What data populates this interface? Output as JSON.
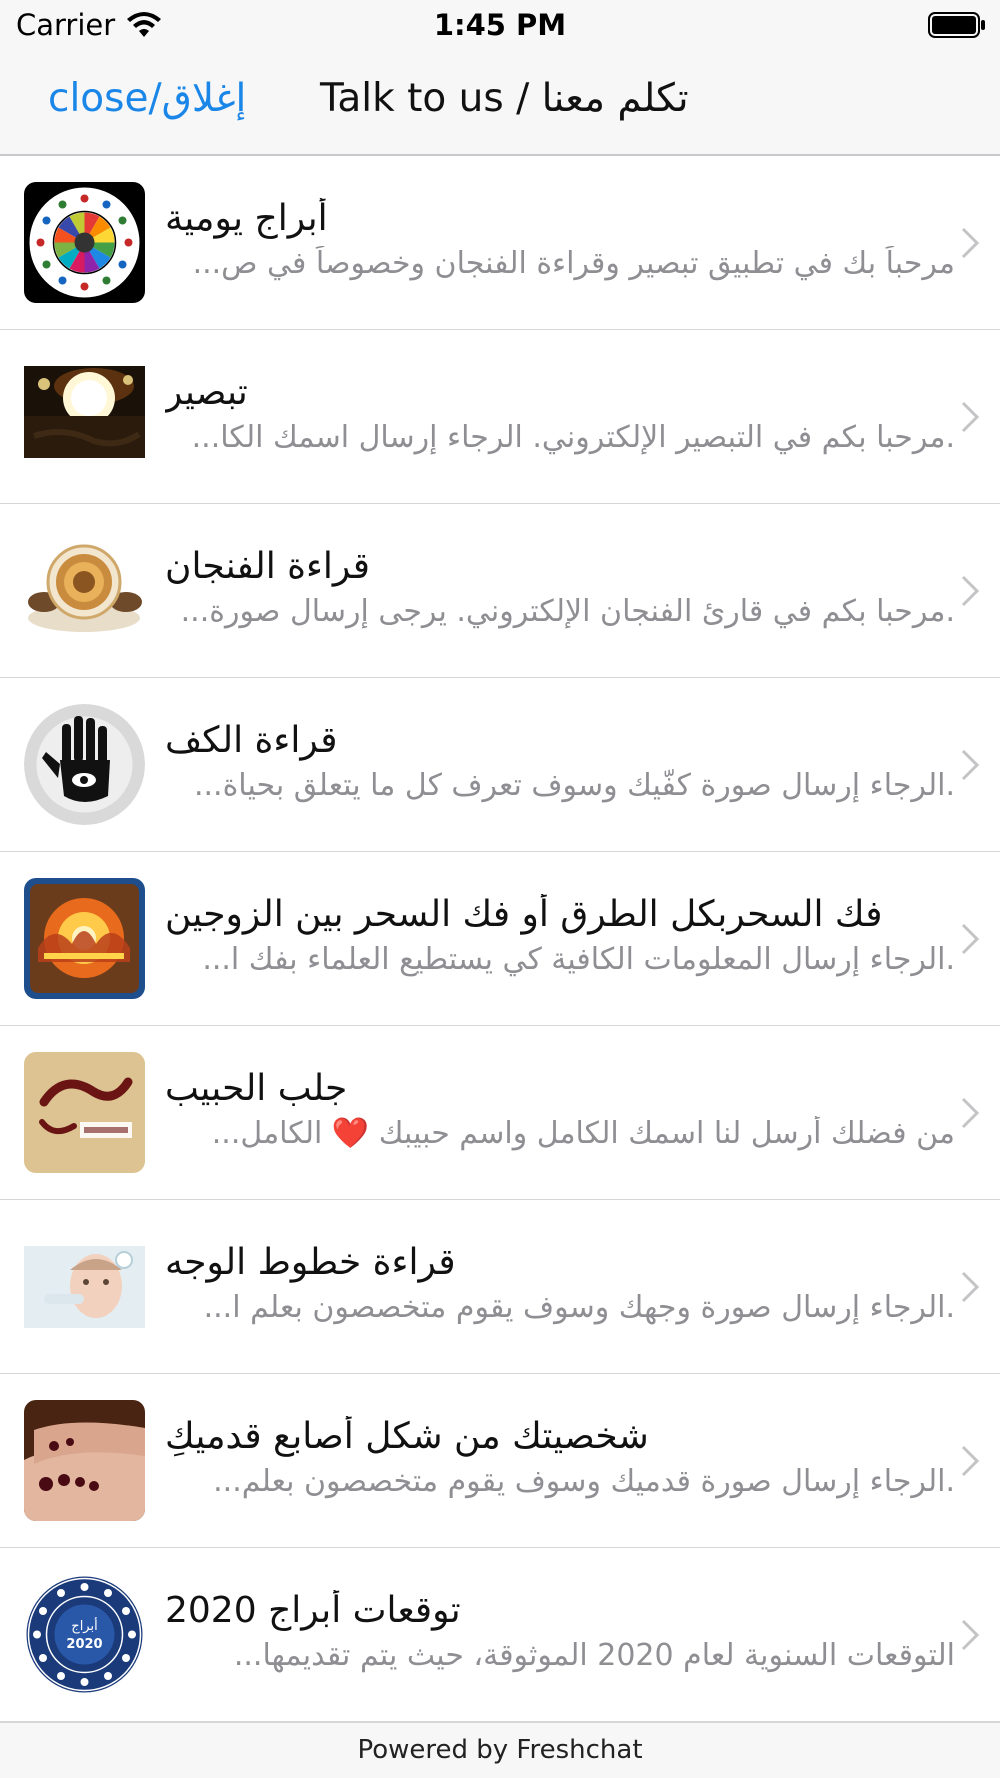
{
  "status_bar": {
    "carrier": "Carrier",
    "time": "1:45 PM"
  },
  "nav": {
    "close_label": "close/إغلاق",
    "title": "Talk to us / تكلم معنا"
  },
  "colors": {
    "accent": "#1a86e8",
    "subtitle": "#8e8e93",
    "bar_bg": "#f7f7f7"
  },
  "items": [
    {
      "title": "أبراج يومية",
      "subtitle": "مرحباً بك في تطبيق تبصير وقراءة الفنجان وخصوصاً في ص...",
      "icon": "zodiac-wheel-icon"
    },
    {
      "title": "تبصير",
      "subtitle": ".مرحبا بكم في التبصير الإلكتروني. الرجاء إرسال اسمك الكا...",
      "icon": "crystal-ball-icon"
    },
    {
      "title": "قراءة الفنجان",
      "subtitle": ".مرحبا بكم في قارئ الفنجان الإلكتروني. يرجى إرسال صورة...",
      "icon": "coffee-cup-icon"
    },
    {
      "title": "قراءة الكف",
      "subtitle": ".الرجاء إرسال صورة كفّيك وسوف تعرف كل ما يتعلق بحياة...",
      "icon": "palm-hand-icon"
    },
    {
      "title": "فك السحربكل الطرق أو فك السحر بين الزوجين",
      "subtitle": ".الرجاء إرسال المعلومات الكافية كي يستطيع العلماء بفك ا...",
      "icon": "magic-fire-icon"
    },
    {
      "title": "جلب الحبيب",
      "subtitle": "من فضلك أرسل لنا اسمك الكامل واسم حبيبك ❤️ الكامل...",
      "icon": "beloved-calligraphy-icon"
    },
    {
      "title": "قراءة خطوط الوجه",
      "subtitle": ".الرجاء إرسال صورة وجهك وسوف يقوم متخصصون بعلم ا...",
      "icon": "face-reading-icon"
    },
    {
      "title": "شخصيتك من شكل أصابع قدميكِ",
      "subtitle": ".الرجاء إرسال صورة قدميك وسوف يقوم متخصصون بعلم...",
      "icon": "feet-icon"
    },
    {
      "title": "توقعات أبراج 2020",
      "subtitle": "التوقعات السنوية لعام 2020 الموثوقة، حيث يتم تقديمها...",
      "icon": "horoscope-2020-icon",
      "badge_line1": "أبراج",
      "badge_line2": "2020"
    }
  ],
  "footer": {
    "text": "Powered by Freshchat"
  }
}
